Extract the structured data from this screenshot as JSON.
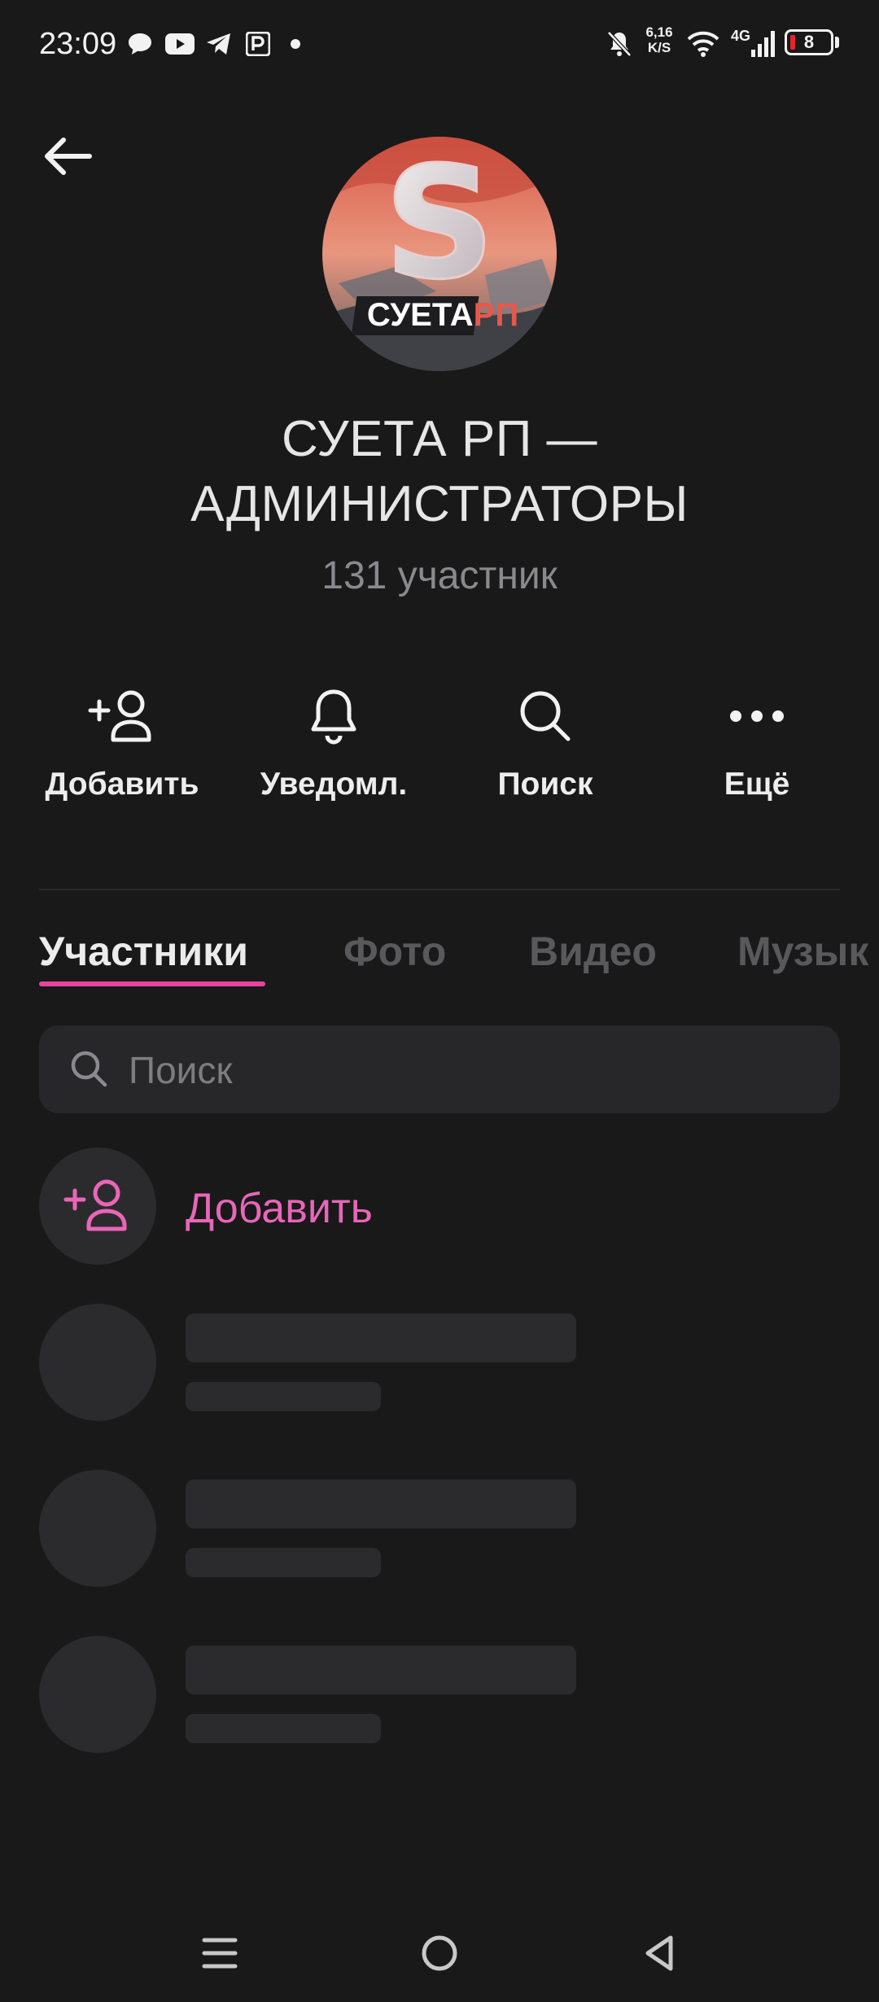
{
  "status_bar": {
    "time": "23:09",
    "net_speed_value": "6,16",
    "net_speed_unit": "K/S",
    "network_type": "4G",
    "battery_level": "8",
    "notification_icons": [
      "chat-bubble-icon",
      "youtube-icon",
      "telegram-icon",
      "parking-icon",
      "dot-icon"
    ],
    "system_icons": [
      "bell-off-icon",
      "wifi-icon",
      "signal-icon",
      "battery-icon"
    ]
  },
  "header": {
    "back_icon": "arrow-left-icon",
    "avatar": {
      "logo_text_part1": "СУЕТА",
      "logo_text_part2": "РП",
      "logo_letter": "S"
    },
    "title": "СУЕТА РП — АДМИНИСТРАТОРЫ",
    "members_count": "131 участник"
  },
  "actions": [
    {
      "icon": "add-user-icon",
      "label": "Добавить"
    },
    {
      "icon": "bell-icon",
      "label": "Уведомл."
    },
    {
      "icon": "search-icon",
      "label": "Поиск"
    },
    {
      "icon": "more-dots-icon",
      "label": "Ещё"
    }
  ],
  "tabs": [
    {
      "label": "Участники",
      "active": true
    },
    {
      "label": "Фото",
      "active": false
    },
    {
      "label": "Видео",
      "active": false
    },
    {
      "label": "Музык",
      "active": false
    }
  ],
  "search": {
    "placeholder": "Поиск",
    "value": ""
  },
  "add_member": {
    "label": "Добавить",
    "icon": "add-user-icon"
  },
  "member_placeholders_count": 3,
  "colors": {
    "accent": "#e866b8",
    "tab_underline": "#e7449f",
    "background": "#19191a",
    "skeleton": "#2b2b2e"
  },
  "nav_bar": [
    "menu-icon",
    "home-icon",
    "back-triangle-icon"
  ]
}
